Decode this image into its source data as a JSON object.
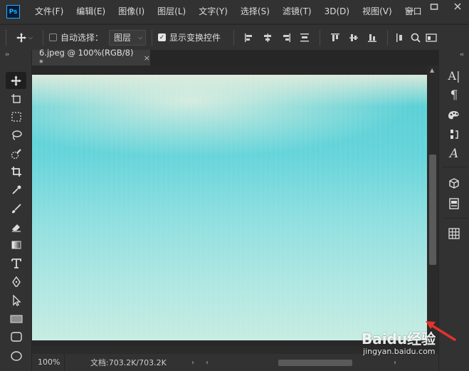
{
  "menu": {
    "logo": "Ps",
    "items": [
      "文件(F)",
      "编辑(E)",
      "图像(I)",
      "图层(L)",
      "文字(Y)",
      "选择(S)",
      "滤镜(T)",
      "3D(D)",
      "视图(V)",
      "窗口"
    ]
  },
  "options": {
    "auto_select_label": "自动选择：",
    "auto_select_checked": false,
    "target_select_value": "图层",
    "show_transform_label": "显示变换控件",
    "show_transform_checked": true
  },
  "document": {
    "tab_title": "6.jpeg @ 100%(RGB/8) *",
    "close_glyph": "×"
  },
  "status": {
    "zoom": "100%",
    "doc_info": "文档:703.2K/703.2K",
    "arrow": "›"
  },
  "tools": [
    "move-tool",
    "artboard-tool",
    "marquee-tool",
    "lasso-tool",
    "quick-select-tool",
    "crop-tool",
    "eyedropper-tool",
    "brush-tool",
    "eraser-tool",
    "gradient-tool",
    "type-tool",
    "pen-tool",
    "path-select-tool",
    "rectangle-tool",
    "rounded-rect-tool",
    "ellipse-tool"
  ],
  "right_panel": {
    "character_glyph": "A|",
    "paragraph_glyph": "¶",
    "glyphs_glyph": "A"
  },
  "watermark": {
    "brand": "Baidu经验",
    "url": "jingyan.baidu.com"
  },
  "colors": {
    "accent": "#31a8ff",
    "arrow": "#e5322d"
  }
}
